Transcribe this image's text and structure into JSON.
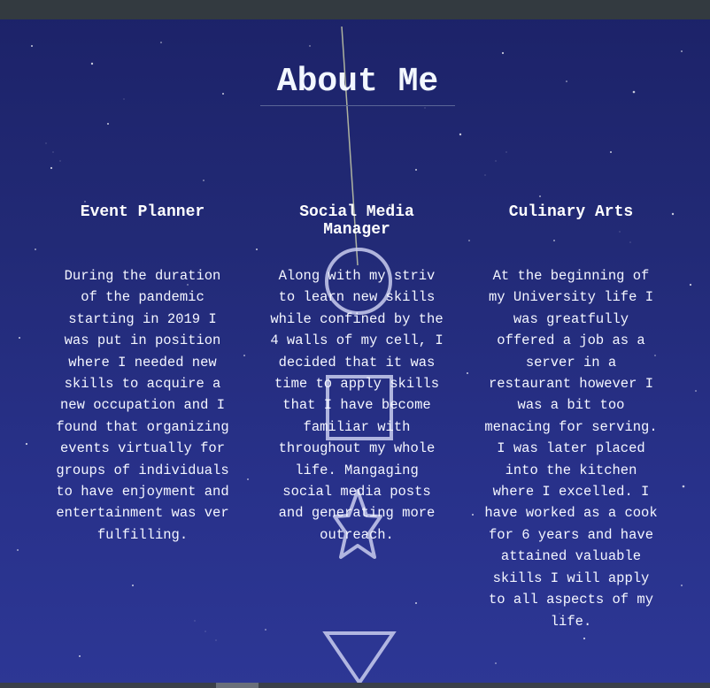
{
  "page": {
    "title": "About Me",
    "background_colors": [
      "#1c2268",
      "#2d3795"
    ]
  },
  "sections": [
    {
      "heading": "Event Planner",
      "body": "During the duration of the pandemic starting in 2019 I was put in position where I needed new skills to acquire a new occupation and I found that organizing events virtually for groups of individuals to have enjoyment and entertainment was ver fulfilling."
    },
    {
      "heading": "Social Media Manager",
      "body": "Along with my striv to learn new skills while confined by the 4 walls of my cell, I decided that it was time to apply skills that I have become familiar with throughout my whole life. Mangaging social media posts and generating more outreach."
    },
    {
      "heading": "Culinary Arts",
      "body": "At the beginning of my University life I was greatfully offered a job as a server in a restaurant however I was a bit too menacing for serving. I was later placed into the kitchen where I excelled. I have worked as a cook for 6 years and have attained valuable skills I will apply to all aspects of my life."
    }
  ],
  "decorations": {
    "shapes": [
      "circle-icon",
      "square-icon",
      "star-icon",
      "triangle-icon"
    ],
    "shape_color": "#c9cdef"
  }
}
